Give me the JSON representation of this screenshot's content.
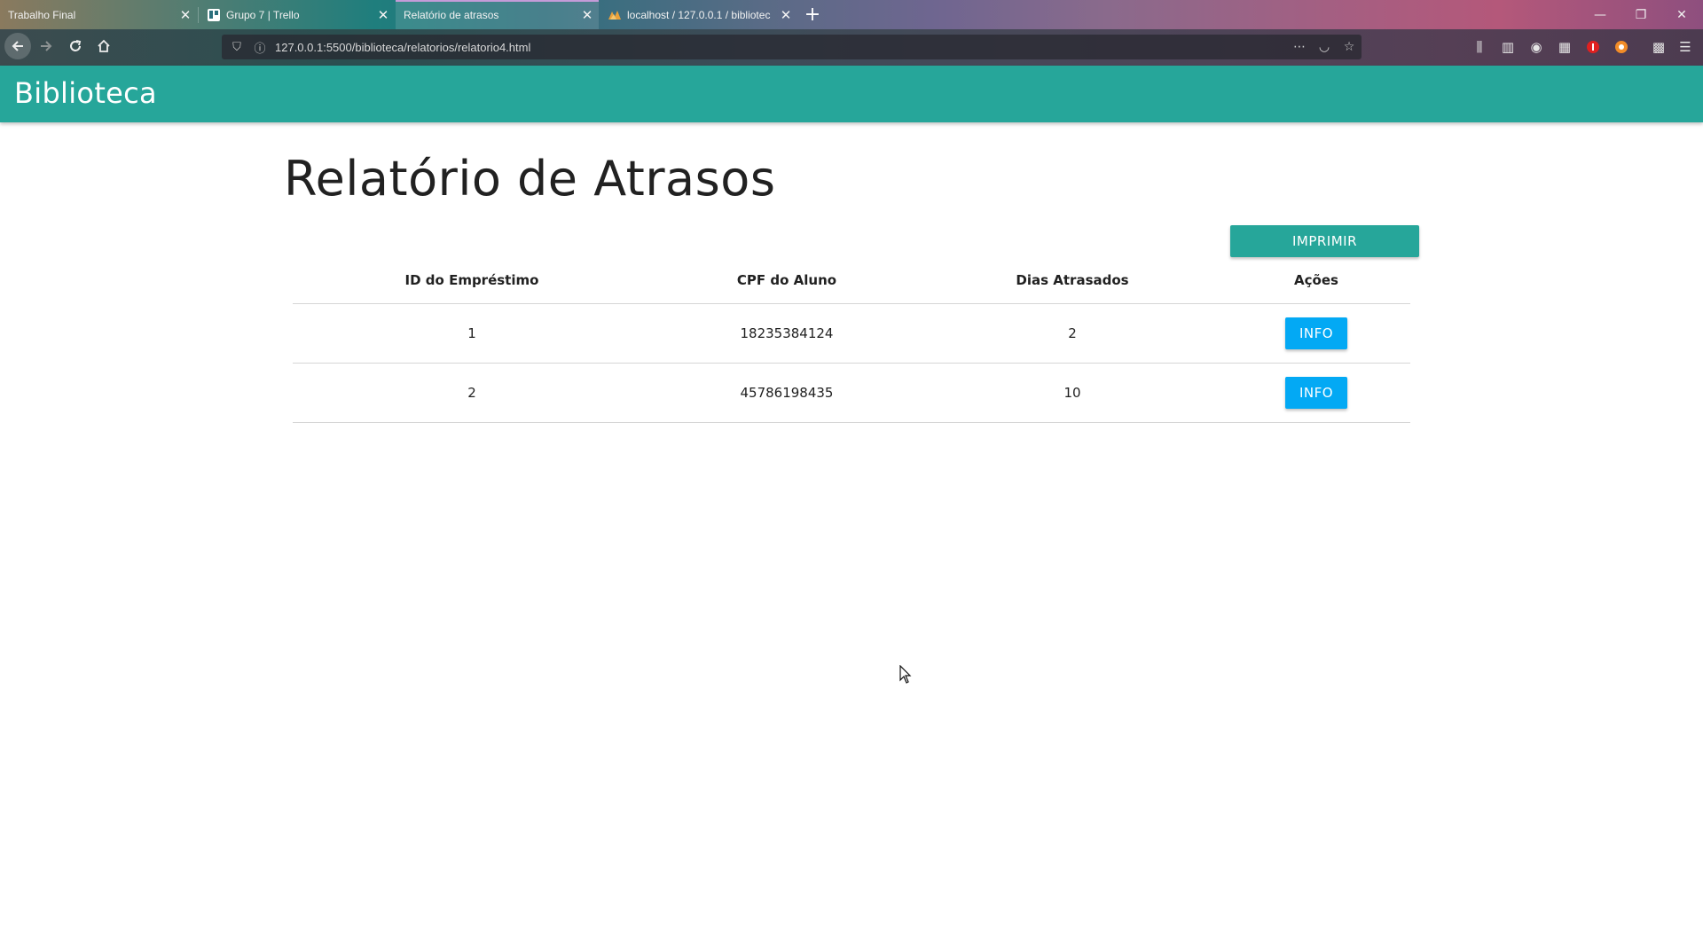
{
  "browser": {
    "tabs": [
      {
        "title": "Trabalho Final",
        "active": false
      },
      {
        "title": "Grupo 7 | Trello",
        "active": false
      },
      {
        "title": "Relatório de atrasos",
        "active": true
      },
      {
        "title": "localhost / 127.0.0.1 / bibliotec",
        "active": false
      }
    ],
    "url": "127.0.0.1:5500/biblioteca/relatorios/relatorio4.html"
  },
  "page": {
    "brand": "Biblioteca",
    "title": "Relatório de Atrasos",
    "print_button": "IMPRIMIR",
    "table": {
      "headers": [
        "ID do Empréstimo",
        "CPF do Aluno",
        "Dias Atrasados",
        "Ações"
      ],
      "rows": [
        {
          "id": "1",
          "cpf": "18235384124",
          "dias": "2",
          "action": "INFO"
        },
        {
          "id": "2",
          "cpf": "45786198435",
          "dias": "10",
          "action": "INFO"
        }
      ]
    }
  },
  "colors": {
    "appbar": "#26a69a",
    "info_button": "#03a9f4"
  }
}
